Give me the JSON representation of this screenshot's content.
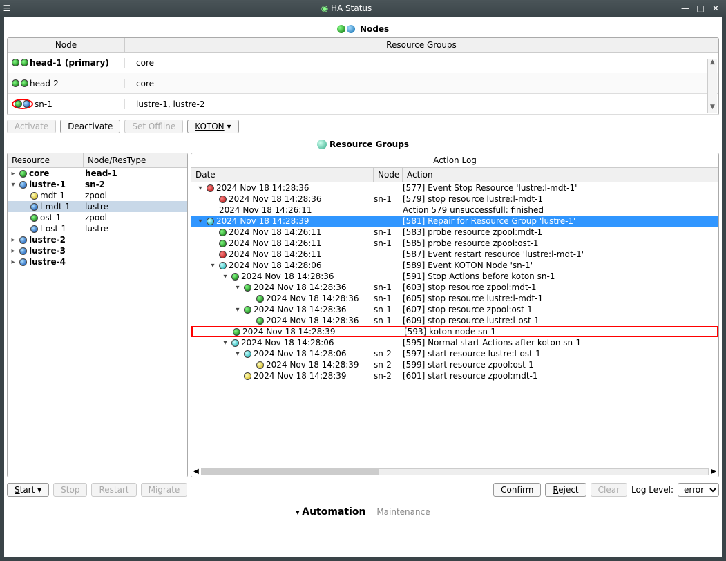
{
  "window": {
    "title": "HA Status"
  },
  "sections": {
    "nodes": "Nodes",
    "resource_groups": "Resource Groups"
  },
  "nodes_table": {
    "headers": {
      "node": "Node",
      "rg": "Resource Groups"
    },
    "rows": [
      {
        "name": "head-1 (primary)",
        "rg": "core",
        "bold": true,
        "dots": [
          "green",
          "green"
        ]
      },
      {
        "name": "head-2",
        "rg": "core",
        "dots": [
          "green",
          "green"
        ]
      },
      {
        "name": "sn-1",
        "rg": "lustre-1, lustre-2",
        "dots": [
          "green",
          "blue"
        ],
        "highlight": true
      }
    ]
  },
  "node_buttons": {
    "activate": "Activate",
    "deactivate": "Deactivate",
    "offline": "Set Offline",
    "koton": "KOTON"
  },
  "tree": {
    "headers": {
      "res": "Resource",
      "node": "Node/ResType"
    },
    "rows": [
      {
        "indent": 0,
        "exp": "▸",
        "dot": "green",
        "label": "core",
        "col2": "head-1",
        "bold": true
      },
      {
        "indent": 0,
        "exp": "▾",
        "dot": "blue",
        "label": "lustre-1",
        "col2": "sn-2",
        "bold": true
      },
      {
        "indent": 1,
        "exp": "",
        "dot": "yellow",
        "label": "mdt-1",
        "col2": "zpool"
      },
      {
        "indent": 1,
        "exp": "",
        "dot": "blue",
        "label": "l-mdt-1",
        "col2": "lustre",
        "selected": true
      },
      {
        "indent": 1,
        "exp": "",
        "dot": "green",
        "label": "ost-1",
        "col2": "zpool"
      },
      {
        "indent": 1,
        "exp": "",
        "dot": "blue",
        "label": "l-ost-1",
        "col2": "lustre"
      },
      {
        "indent": 0,
        "exp": "▸",
        "dot": "blue",
        "label": "lustre-2",
        "col2": "",
        "bold": true
      },
      {
        "indent": 0,
        "exp": "▸",
        "dot": "blue",
        "label": "lustre-3",
        "col2": "",
        "bold": true
      },
      {
        "indent": 0,
        "exp": "▸",
        "dot": "blue",
        "label": "lustre-4",
        "col2": "",
        "bold": true
      }
    ]
  },
  "action_log": {
    "title": "Action Log",
    "headers": {
      "date": "Date",
      "node": "Node",
      "action": "Action"
    },
    "rows": [
      {
        "indent": 0,
        "exp": "▾",
        "dot": "red",
        "date": "2024 Nov 18 14:28:36",
        "node": "",
        "action": "[577] Event Stop Resource 'lustre:l-mdt-1'"
      },
      {
        "indent": 1,
        "exp": "",
        "dot": "red",
        "date": "2024 Nov 18 14:28:36",
        "node": "sn-1",
        "action": "[579] stop resource lustre:l-mdt-1"
      },
      {
        "indent": 1,
        "exp": "",
        "dot": "",
        "date": "2024 Nov 18 14:26:11",
        "node": "",
        "action": "Action 579 unsuccessfull: finished"
      },
      {
        "indent": 0,
        "exp": "▾",
        "dot": "cyan",
        "date": "2024 Nov 18 14:28:39",
        "node": "",
        "action": "[581] Repair for Resource Group 'lustre-1'",
        "selected": true
      },
      {
        "indent": 1,
        "exp": "",
        "dot": "green",
        "date": "2024 Nov 18 14:26:11",
        "node": "sn-1",
        "action": "[583] probe resource zpool:mdt-1"
      },
      {
        "indent": 1,
        "exp": "",
        "dot": "green",
        "date": "2024 Nov 18 14:26:11",
        "node": "sn-1",
        "action": "[585] probe resource zpool:ost-1"
      },
      {
        "indent": 1,
        "exp": "",
        "dot": "red",
        "date": "2024 Nov 18 14:26:11",
        "node": "",
        "action": "[587] Event restart resource 'lustre:l-mdt-1'"
      },
      {
        "indent": 1,
        "exp": "▾",
        "dot": "cyan",
        "date": "2024 Nov 18 14:28:06",
        "node": "",
        "action": "[589] Event KOTON Node 'sn-1'"
      },
      {
        "indent": 2,
        "exp": "▾",
        "dot": "green",
        "date": "2024 Nov 18 14:28:36",
        "node": "",
        "action": "[591] Stop Actions before koton sn-1"
      },
      {
        "indent": 3,
        "exp": "▾",
        "dot": "green",
        "date": "2024 Nov 18 14:28:36",
        "node": "sn-1",
        "action": "[603] stop resource zpool:mdt-1"
      },
      {
        "indent": 4,
        "exp": "",
        "dot": "green",
        "date": "2024 Nov 18 14:28:36",
        "node": "sn-1",
        "action": "[605] stop resource lustre:l-mdt-1"
      },
      {
        "indent": 3,
        "exp": "▾",
        "dot": "green",
        "date": "2024 Nov 18 14:28:36",
        "node": "sn-1",
        "action": "[607] stop resource zpool:ost-1"
      },
      {
        "indent": 4,
        "exp": "",
        "dot": "green",
        "date": "2024 Nov 18 14:28:36",
        "node": "sn-1",
        "action": "[609] stop resource lustre:l-ost-1"
      },
      {
        "indent": 2,
        "exp": "",
        "dot": "green",
        "date": "2024 Nov 18 14:28:39",
        "node": "",
        "action": "[593] koton node sn-1",
        "redbox": true
      },
      {
        "indent": 2,
        "exp": "▾",
        "dot": "cyan",
        "date": "2024 Nov 18 14:28:06",
        "node": "",
        "action": "[595] Normal start Actions after koton sn-1"
      },
      {
        "indent": 3,
        "exp": "▾",
        "dot": "cyan",
        "date": "2024 Nov 18 14:28:06",
        "node": "sn-2",
        "action": "[597] start resource lustre:l-ost-1"
      },
      {
        "indent": 4,
        "exp": "",
        "dot": "yellow",
        "date": "2024 Nov 18 14:28:39",
        "node": "sn-2",
        "action": "[599] start resource zpool:ost-1"
      },
      {
        "indent": 3,
        "exp": "",
        "dot": "yellow",
        "date": "2024 Nov 18 14:28:39",
        "node": "sn-2",
        "action": "[601] start resource zpool:mdt-1"
      }
    ]
  },
  "resource_buttons": {
    "start": "Start",
    "stop": "Stop",
    "restart": "Restart",
    "migrate": "Migrate"
  },
  "log_buttons": {
    "confirm": "Confirm",
    "reject": "Reject",
    "clear": "Clear",
    "loglevel_label": "Log Level:",
    "loglevel": "error"
  },
  "automation": {
    "label": "Automation",
    "sub": "Maintenance"
  }
}
